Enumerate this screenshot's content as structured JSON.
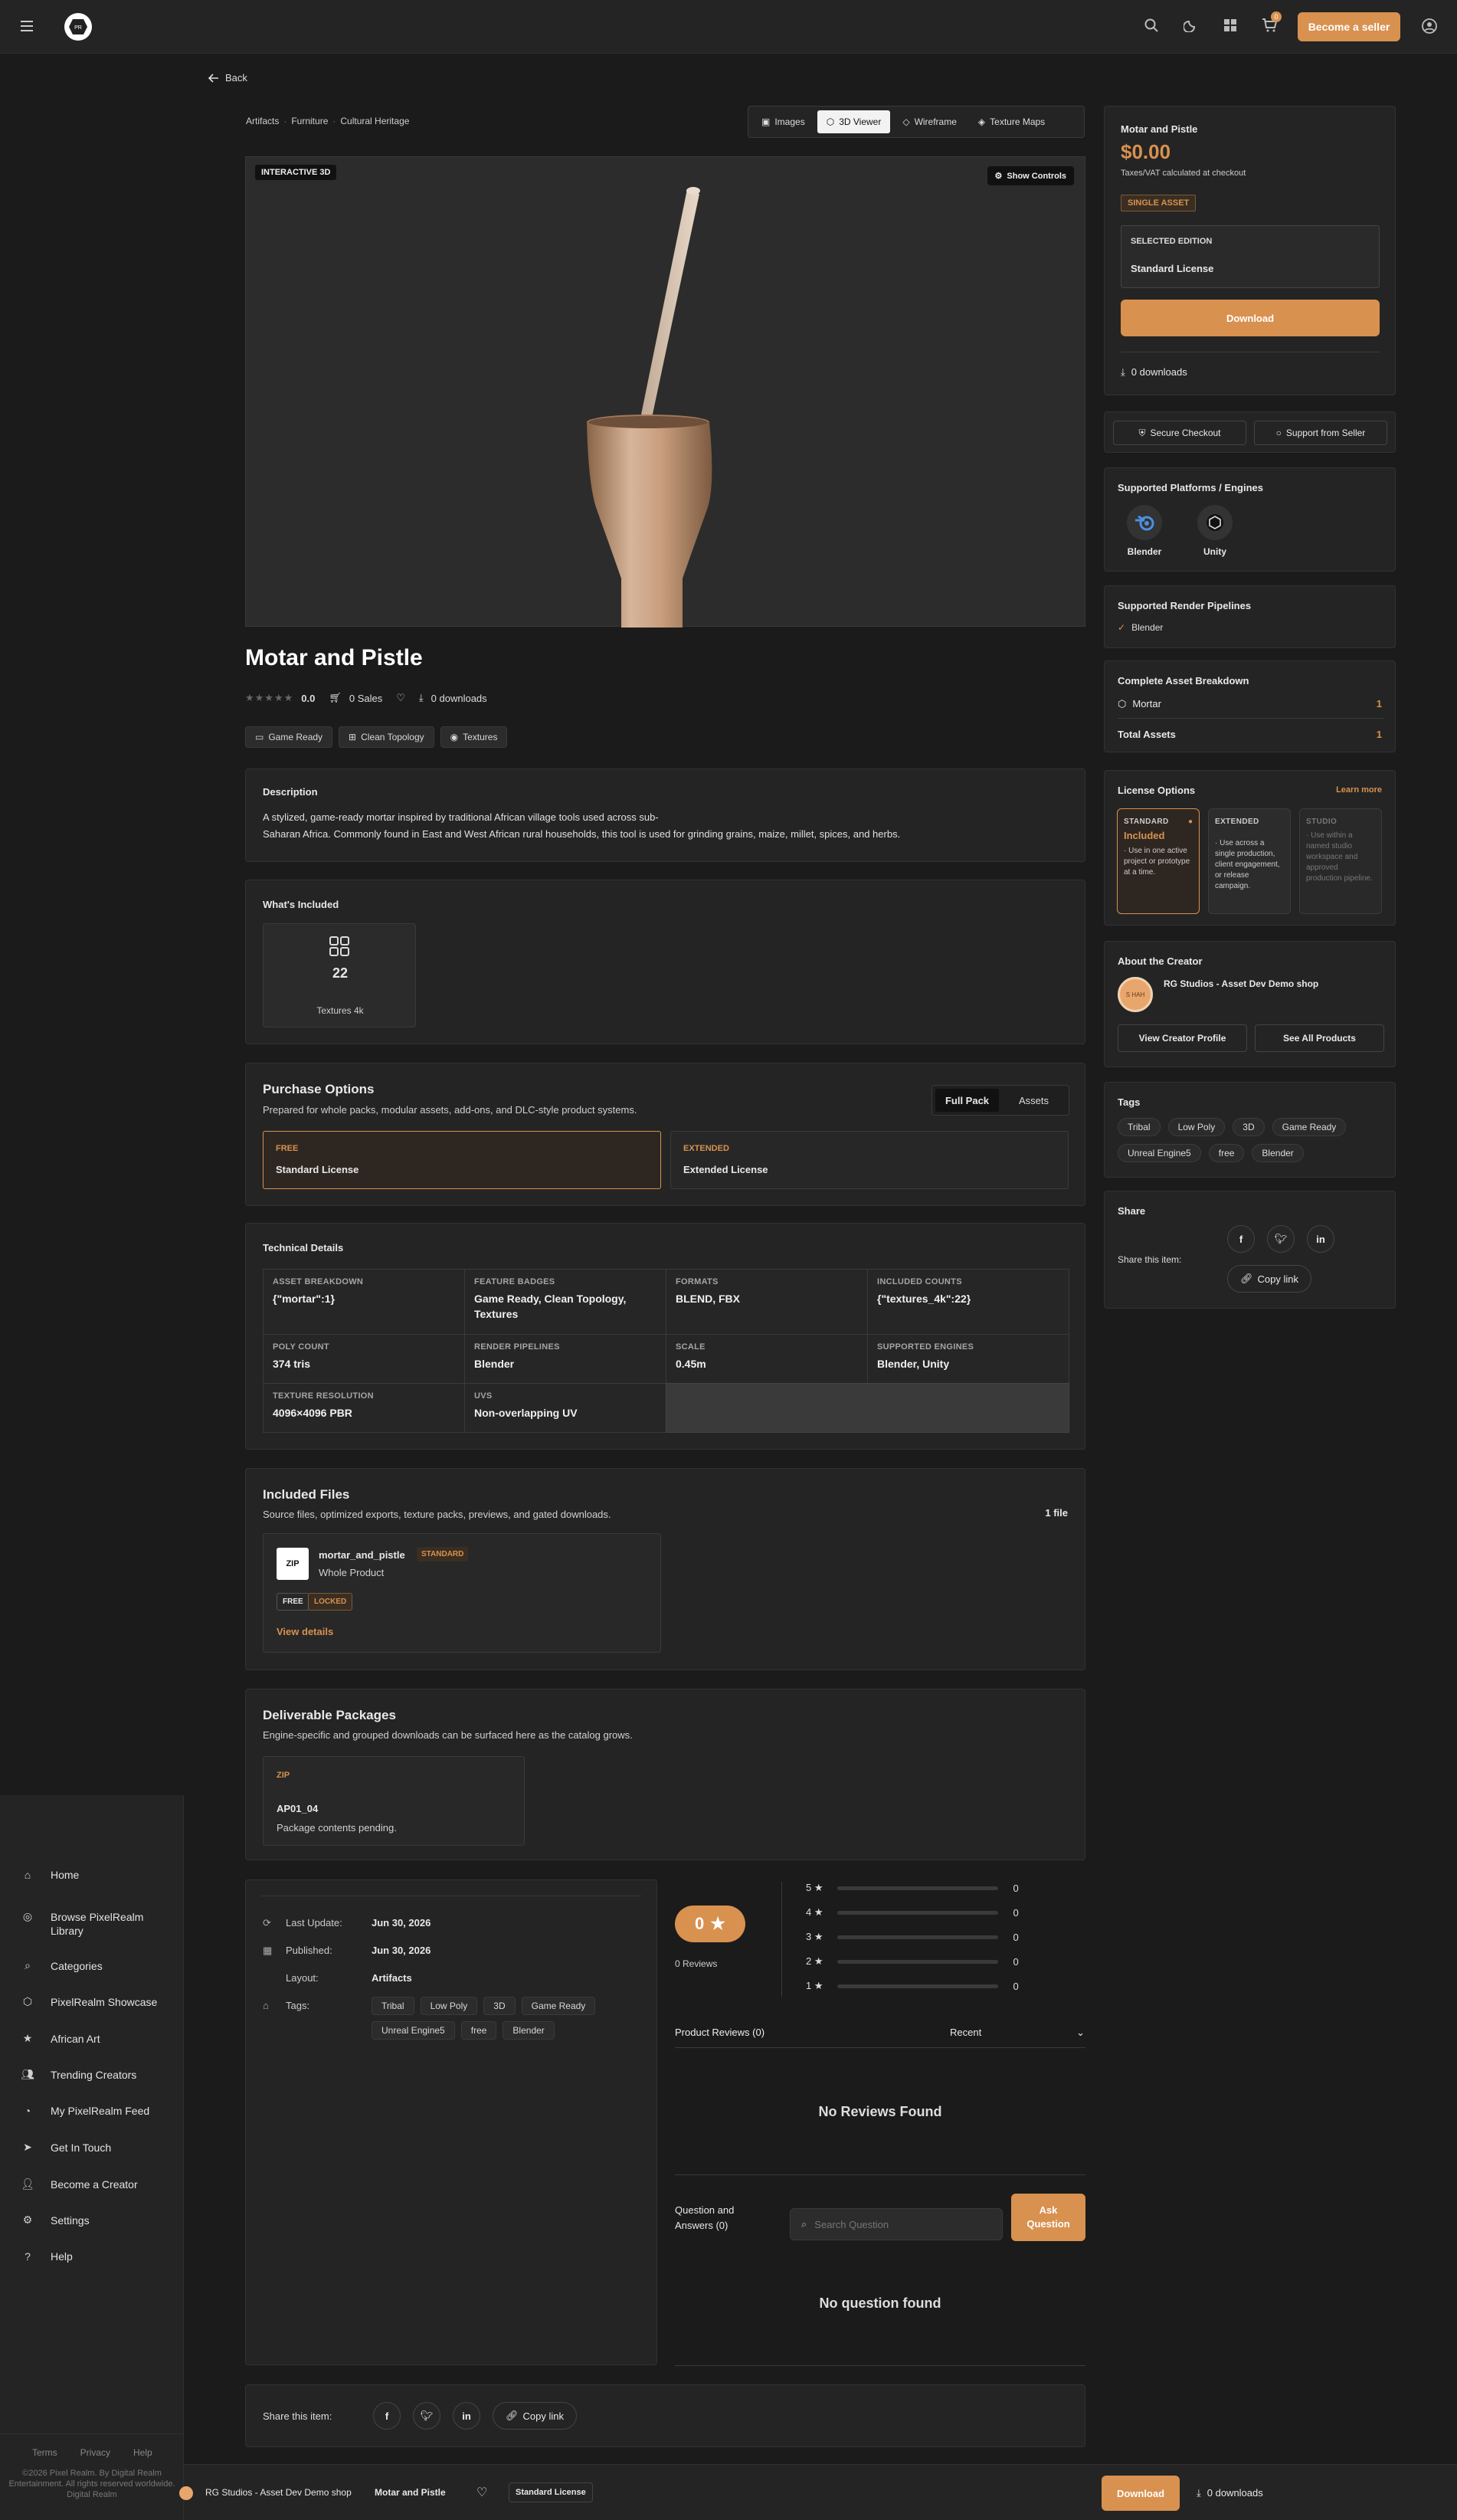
{
  "header": {
    "become_seller": "Become a seller",
    "cart_count": "0"
  },
  "nav": {
    "back": "Back"
  },
  "breadcrumb": [
    "Artifacts",
    "Furniture",
    "Cultural Heritage"
  ],
  "viewer_tabs": [
    "Images",
    "3D Viewer",
    "Wireframe",
    "Texture Maps"
  ],
  "viewer": {
    "badge": "INTERACTIVE 3D",
    "show_controls": "Show Controls"
  },
  "product": {
    "title": "Motar and Pistle",
    "rating": "0.0",
    "sales": "0 Sales",
    "downloads": "0 downloads",
    "features": [
      "Game Ready",
      "Clean Topology",
      "Textures"
    ]
  },
  "description": {
    "heading": "Description",
    "line1": "A stylized, game-ready mortar inspired by traditional African village tools used across sub-",
    "line2": "Saharan Africa. Commonly found in East and West African rural households, this tool is used for grinding grains, maize, millet, spices, and herbs."
  },
  "included": {
    "heading": "What's Included",
    "count": "22",
    "label": "Textures 4k"
  },
  "purchase": {
    "heading": "Purchase Options",
    "sub": "Prepared for whole packs, modular assets, add-ons, and DLC-style product systems.",
    "toggle": [
      "Full Pack",
      "Assets"
    ],
    "free_tag": "FREE",
    "free_name": "Standard License",
    "ext_tag": "EXTENDED",
    "ext_name": "Extended License"
  },
  "tech": {
    "heading": "Technical Details",
    "cells": [
      {
        "k": "ASSET BREAKDOWN",
        "v": "{\"mortar\":1}"
      },
      {
        "k": "FEATURE BADGES",
        "v": "Game Ready, Clean Topology, Textures"
      },
      {
        "k": "FORMATS",
        "v": "BLEND, FBX"
      },
      {
        "k": "INCLUDED COUNTS",
        "v": "{\"textures_4k\":22}"
      },
      {
        "k": "POLY COUNT",
        "v": "374 tris"
      },
      {
        "k": "RENDER PIPELINES",
        "v": "Blender"
      },
      {
        "k": "SCALE",
        "v": "0.45m"
      },
      {
        "k": "SUPPORTED ENGINES",
        "v": "Blender, Unity"
      },
      {
        "k": "TEXTURE RESOLUTION",
        "v": "4096×4096 PBR"
      },
      {
        "k": "UVS",
        "v": "Non-overlapping UV"
      }
    ]
  },
  "files": {
    "heading": "Included Files",
    "sub": "Source files, optimized exports, texture packs, previews, and gated downloads.",
    "count": "1 file",
    "zip": "ZIP",
    "name": "mortar_and_pistle",
    "badge": "STANDARD",
    "type": "Whole Product",
    "free": "FREE",
    "locked": "LOCKED",
    "details": "View details"
  },
  "packages": {
    "heading": "Deliverable Packages",
    "sub": "Engine-specific and grouped downloads can be surfaced here as the catalog grows.",
    "zip": "ZIP",
    "name": "AP01_04",
    "status": "Package contents pending."
  },
  "meta": {
    "last_update_k": "Last Update:",
    "last_update_v": "Jun 30, 2026",
    "published_k": "Published:",
    "published_v": "Jun 30, 2026",
    "layout_k": "Layout:",
    "layout_v": "Artifacts",
    "tags_k": "Tags:",
    "tags": [
      "Tribal",
      "Low Poly",
      "3D",
      "Game Ready",
      "Unreal Engine5",
      "free",
      "Blender"
    ]
  },
  "reviews": {
    "score": "0",
    "count": "0 Reviews",
    "rows": [
      {
        "s": "5 ★",
        "c": "0"
      },
      {
        "s": "4 ★",
        "c": "0"
      },
      {
        "s": "3 ★",
        "c": "0"
      },
      {
        "s": "2 ★",
        "c": "0"
      },
      {
        "s": "1 ★",
        "c": "0"
      }
    ],
    "product_reviews": "Product Reviews (0)",
    "sort": "Recent",
    "empty": "No Reviews Found",
    "qa_title": "Question and Answers (0)",
    "search_placeholder": "Search Question",
    "ask": "Ask Question",
    "qa_empty": "No question found"
  },
  "share": {
    "label": "Share this item:",
    "copy": "Copy link",
    "heading": "Share"
  },
  "sidebar": {
    "items": [
      "Home",
      "Browse PixelRealm Library",
      "Categories",
      "PixelRealm Showcase",
      "African Art",
      "Trending Creators",
      "My PixelRealm Feed",
      "Get In Touch",
      "Become a Creator",
      "Settings",
      "Help"
    ],
    "footer_links": [
      "Terms",
      "Privacy",
      "Help"
    ],
    "copyright": "©2026 Pixel Realm. By Digital Realm Entertainment. All rights reserved worldwide. Digital Realm"
  },
  "price_card": {
    "title": "Motar and Pistle",
    "price": "$0.00",
    "tax": "Taxes/VAT calculated at checkout",
    "badge": "SINGLE ASSET",
    "edition_label": "SELECTED EDITION",
    "edition": "Standard License",
    "download": "Download",
    "downloads": "0 downloads"
  },
  "trust": {
    "secure": "Secure Checkout",
    "support": "Support from Seller"
  },
  "platforms": {
    "heading": "Supported Platforms / Engines",
    "items": [
      "Blender",
      "Unity"
    ]
  },
  "pipelines": {
    "heading": "Supported Render Pipelines",
    "items": [
      "Blender"
    ]
  },
  "breakdown": {
    "heading": "Complete Asset Breakdown",
    "item": "Mortar",
    "item_count": "1",
    "total": "Total Assets",
    "total_count": "1"
  },
  "license_options": {
    "heading": "License Options",
    "learn": "Learn more",
    "standard_t": "STANDARD",
    "standard_inc": "Included",
    "standard_d": "· Use in one active project or prototype at a time.",
    "extended_t": "EXTENDED",
    "extended_d": "· Use across a single production, client engagement, or release campaign.",
    "studio_t": "STUDIO",
    "studio_d": "· Use within a named studio workspace and approved production pipeline."
  },
  "creator": {
    "heading": "About the Creator",
    "name": "RG Studios - Asset Dev Demo shop",
    "avatar": "S HAH",
    "profile": "View Creator Profile",
    "products": "See All Products"
  },
  "tags_card": {
    "heading": "Tags",
    "tags": [
      "Tribal",
      "Low Poly",
      "3D",
      "Game Ready",
      "Unreal Engine5",
      "free",
      "Blender"
    ]
  },
  "bottom_bar": {
    "shop": "RG Studios - Asset Dev Demo shop",
    "product": "Motar and Pistle",
    "license": "Standard License",
    "download": "Download",
    "downloads": "0 downloads"
  },
  "colors": {
    "accent": "#d8914f",
    "bg": "#1b1b1b",
    "card": "#242424"
  }
}
